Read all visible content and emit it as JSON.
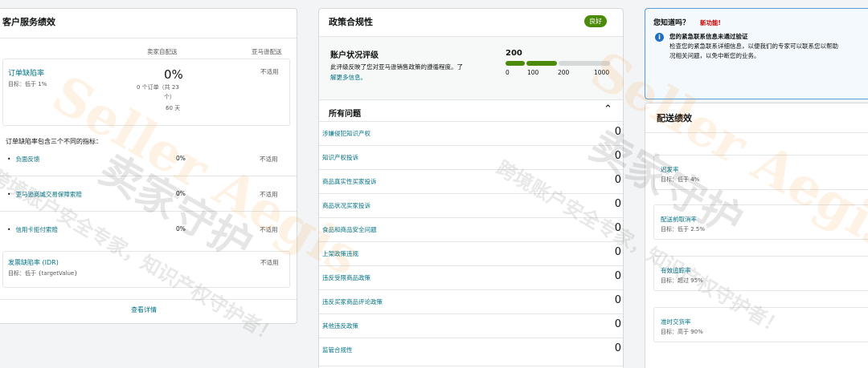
{
  "left": {
    "title": "客户服务绩效",
    "col_seller": "卖家自配送",
    "col_amazon": "亚马逊配送",
    "odr": {
      "label": "订单缺陷率",
      "target": "目标：低于 1%",
      "value": "0%",
      "detail1": "0 个订单（共 23",
      "detail2": "个）",
      "detail3": "60 天",
      "amazon": "不适用"
    },
    "metrics_intro": "订单缺陷率包含三个不同的指标：",
    "metrics": [
      {
        "label": "负面反馈",
        "value": "0%",
        "amazon": "不适用"
      },
      {
        "label": "亚马逊商城交易保障索赔",
        "value": "0%",
        "amazon": "不适用"
      },
      {
        "label": "信用卡拒付索赔",
        "value": "0%",
        "amazon": "不适用"
      }
    ],
    "idr": {
      "label": "发票缺陷率 (IDR)",
      "target": "目标：低于 {targetValue}",
      "amazon": "不适用"
    },
    "details_link": "查看详情"
  },
  "mid": {
    "title": "政策合规性",
    "badge": "良好",
    "rating": {
      "title": "账户状况评级",
      "desc1": "此评级反映了您对亚马逊销售政策的遵循程度。了",
      "desc2": "解更多信息。",
      "score": "200",
      "ticks": [
        "0",
        "100",
        "200",
        "1000"
      ],
      "score_fraction": 0.2
    },
    "issues_title": "所有问题",
    "issues": [
      {
        "label": "涉嫌侵犯知识产权",
        "value": "0"
      },
      {
        "label": "知识产权投诉",
        "value": "0"
      },
      {
        "label": "商品真实性买家投诉",
        "value": "0"
      },
      {
        "label": "商品状况买家投诉",
        "value": "0"
      },
      {
        "label": "食品和商品安全问题",
        "value": "0"
      },
      {
        "label": "上架政策违规",
        "value": "0"
      },
      {
        "label": "违反受限商品政策",
        "value": "0"
      },
      {
        "label": "违反买家商品评论政策",
        "value": "0"
      },
      {
        "label": "其他违反政策",
        "value": "0"
      },
      {
        "label": "监管合规性",
        "value": "0"
      }
    ]
  },
  "know": {
    "title": "您知道吗？",
    "new": "新功能!",
    "headline": "您的紧急联系信息未通过验证",
    "body1": "检查您的紧急联系详细信息，以便我们的专家可以联系您以帮助",
    "body2": "况相关问题，以免中断您的业务。"
  },
  "ship": {
    "title": "配送绩效",
    "items": [
      {
        "label": "迟发率",
        "target": "目标：低于 4%"
      },
      {
        "label": "配送前取消率",
        "target": "目标：低于 2.5%"
      },
      {
        "label": "有效追踪率",
        "target": "目标：超过 95%"
      },
      {
        "label": "准时交货率",
        "target": "目标：高于 90%"
      }
    ]
  },
  "watermark": {
    "brand": "Seller Aegis",
    "cn": "卖家守护",
    "tagline": "跨境账户安全专家，知识产权守护者！"
  },
  "colors": {
    "link": "#007185",
    "good": "#4b8a0a",
    "bar_gray": "#d5d9d9",
    "info_blue": "#1f6fc5",
    "new_red": "#c40000"
  }
}
